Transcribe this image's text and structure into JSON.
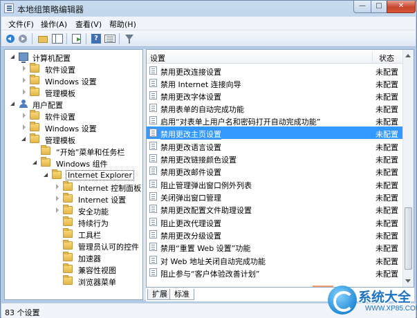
{
  "window": {
    "title": "本地组策略编辑器"
  },
  "menubar": [
    {
      "label": "文件(F)"
    },
    {
      "label": "操作(A)"
    },
    {
      "label": "查看(V)"
    },
    {
      "label": "帮助(H)"
    }
  ],
  "toolbar": {
    "icons": [
      "back-icon",
      "forward-icon",
      "up-folder-icon",
      "show-pane-icon",
      "export-icon",
      "help-icon",
      "properties-icon",
      "filter-icon"
    ]
  },
  "tree": {
    "items": [
      {
        "label": "计算机配置",
        "icon": "computer-icon",
        "expander": "open"
      },
      {
        "label": "软件设置",
        "icon": "folder-icon",
        "expander": "closed"
      },
      {
        "label": "Windows 设置",
        "icon": "folder-icon",
        "expander": "closed"
      },
      {
        "label": "管理模板",
        "icon": "folder-icon",
        "expander": "closed"
      },
      {
        "label": "用户配置",
        "icon": "user-icon",
        "expander": "open"
      },
      {
        "label": "软件设置",
        "icon": "folder-icon",
        "expander": "closed"
      },
      {
        "label": "Windows 设置",
        "icon": "folder-icon",
        "expander": "closed"
      },
      {
        "label": "管理模板",
        "icon": "folder-icon",
        "expander": "open"
      },
      {
        "label": "“开始”菜单和任务栏",
        "icon": "folder-icon",
        "expander": "none"
      },
      {
        "label": "Windows 组件",
        "icon": "folder-icon",
        "expander": "open"
      },
      {
        "label": "Internet Explorer",
        "icon": "folder-icon",
        "expander": "open",
        "selected": true
      },
      {
        "label": "Internet 控制面板",
        "icon": "folder-icon",
        "expander": "closed"
      },
      {
        "label": "Internet 设置",
        "icon": "folder-icon",
        "expander": "closed"
      },
      {
        "label": "安全功能",
        "icon": "folder-icon",
        "expander": "closed"
      },
      {
        "label": "持续行为",
        "icon": "folder-icon",
        "expander": "none"
      },
      {
        "label": "工具栏",
        "icon": "folder-icon",
        "expander": "none"
      },
      {
        "label": "管理员认可的控件",
        "icon": "folder-icon",
        "expander": "none"
      },
      {
        "label": "加速器",
        "icon": "folder-icon",
        "expander": "none"
      },
      {
        "label": "兼容性视图",
        "icon": "folder-icon",
        "expander": "none"
      },
      {
        "label": "浏览器菜单",
        "icon": "folder-icon",
        "expander": "none"
      }
    ]
  },
  "list": {
    "headers": {
      "setting": "设置",
      "state": "状态"
    },
    "rows": [
      {
        "name": "禁用更改连接设置",
        "state": "未配置"
      },
      {
        "name": "禁用 Internet 连接向导",
        "state": "未配置"
      },
      {
        "name": "禁用更改字体设置",
        "state": "未配置"
      },
      {
        "name": "禁用表单的自动完成功能",
        "state": "未配置"
      },
      {
        "name": "启用“对表单上用户名和密码打开自动完成功能”",
        "state": "未配置"
      },
      {
        "name": "禁用更改主页设置",
        "state": "未配置",
        "selected": true
      },
      {
        "name": "禁用更改语言设置",
        "state": "未配置"
      },
      {
        "name": "禁用更改链接颜色设置",
        "state": "未配置"
      },
      {
        "name": "禁用更改邮件设置",
        "state": "未配置"
      },
      {
        "name": "阻止管理弹出窗口例外列表",
        "state": "未配置"
      },
      {
        "name": "关闭弹出窗口管理",
        "state": "未配置"
      },
      {
        "name": "禁用更改配置文件助理设置",
        "state": "未配置"
      },
      {
        "name": "阻止更改代理设置",
        "state": "未配置"
      },
      {
        "name": "禁用更改分级设置",
        "state": "未配置"
      },
      {
        "name": "禁用“重置 Web 设置”功能",
        "state": "未配置"
      },
      {
        "name": "对 Web 地址关闭自动完成功能",
        "state": "未配置"
      },
      {
        "name": "阻止参与“客户体验改善计划”",
        "state": "未配置"
      }
    ]
  },
  "tabs": [
    {
      "label": "扩展"
    },
    {
      "label": "标准",
      "active": true
    }
  ],
  "status": {
    "text": "83 个设置"
  },
  "watermark": {
    "title": "系统大全",
    "url": "WWW.XP85.COM"
  }
}
